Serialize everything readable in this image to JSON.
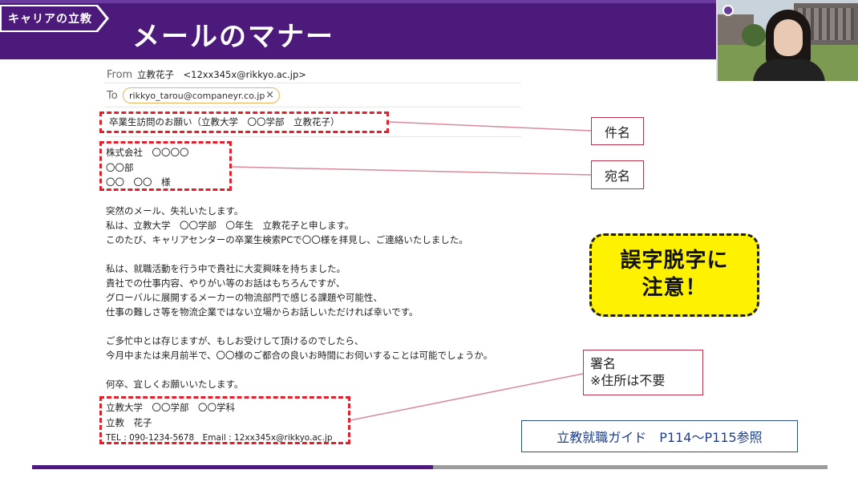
{
  "header": {
    "brand": "キャリアの立教",
    "title": "メールのマナー"
  },
  "email": {
    "from_label": "From",
    "from_value": "立教花子　<12xx345x@rikkyo.ac.jp>",
    "to_label": "To",
    "to_value": "rikkyo_tarou@companeyr.co.jp",
    "to_remove": "×",
    "subject": "卒業生訪問のお願い（立教大学　〇〇学部　立教花子）",
    "address": [
      "株式会社　〇〇〇〇",
      "〇〇部",
      "〇〇　〇〇　様"
    ],
    "body": [
      "突然のメール、失礼いたします。",
      "私は、立教大学　〇〇学部　〇年生　立教花子と申します。",
      "このたび、キャリアセンターの卒業生検索PCで〇〇様を拝見し、ご連絡いたしました。",
      "",
      "私は、就職活動を行う中で貴社に大変興味を持ちました。",
      "貴社での仕事内容、やりがい等のお話はもちろんですが、",
      "グローバルに展開するメーカーの物流部門で感じる課題や可能性、",
      "仕事の難しさ等を物流企業ではない立場からお話しいただければ幸いです。",
      "",
      "ご多忙中とは存じますが、もしお受けして頂けるのでしたら、",
      "今月中または来月前半で、〇〇様のご都合の良いお時間にお伺いすることは可能でしょうか。",
      "",
      "何卒、宜しくお願いいたします。"
    ],
    "signature": [
      "立教大学　〇〇学部　〇〇学科",
      "立教　花子",
      "TEL : 090-1234-5678　Email : 12xx345x@rikkyo.ac.jp"
    ]
  },
  "callouts": {
    "subject": "件名",
    "address": "宛名",
    "signature_line1": "署名",
    "signature_line2": "※住所は不要"
  },
  "warning": {
    "line1": "誤字脱字に",
    "line2": "注意！"
  },
  "guide": "立教就職ガイド　P114～P115参照",
  "colors": {
    "brand_purple": "#4b1a7a",
    "dash_red": "#e0202a",
    "warning_yellow": "#fff200",
    "guide_blue": "#1e3f8c"
  }
}
